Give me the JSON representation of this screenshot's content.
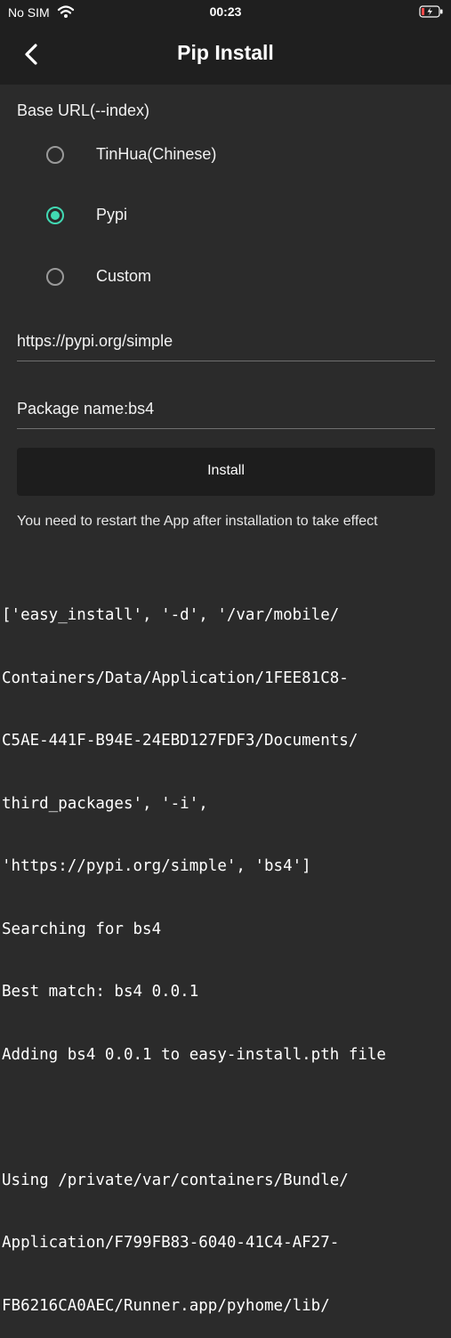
{
  "status_bar": {
    "carrier": "No SIM",
    "time": "00:23"
  },
  "nav": {
    "title": "Pip Install"
  },
  "base_url": {
    "label": "Base URL(--index)",
    "options": [
      {
        "label": "TinHua(Chinese)",
        "selected": false
      },
      {
        "label": "Pypi",
        "selected": true
      },
      {
        "label": "Custom",
        "selected": false
      }
    ]
  },
  "url_field": {
    "value": "https://pypi.org/simple"
  },
  "package_field": {
    "value": "Package name:bs4"
  },
  "install_button": {
    "label": "Install"
  },
  "note": "You need to restart the App after installation to take effect",
  "log_lines": [
    "['easy_install', '-d', '/var/mobile/",
    "Containers/Data/Application/1FEE81C8-",
    "C5AE-441F-B94E-24EBD127FDF3/Documents/",
    "third_packages', '-i',",
    "'https://pypi.org/simple', 'bs4']",
    "Searching for bs4",
    "Best match: bs4 0.0.1",
    "Adding bs4 0.0.1 to easy-install.pth file",
    "",
    "Using /private/var/containers/Bundle/",
    "Application/F799FB83-6040-41C4-AF27-",
    "FB6216CA0AEC/Runner.app/pyhome/lib/"
  ],
  "colors": {
    "accent": "#41d9b3",
    "background": "#2b2b2b",
    "bar": "#1f1f1f"
  },
  "icons": {
    "back": "chevron-left-icon",
    "wifi": "wifi-icon",
    "battery": "battery-charging-icon"
  }
}
